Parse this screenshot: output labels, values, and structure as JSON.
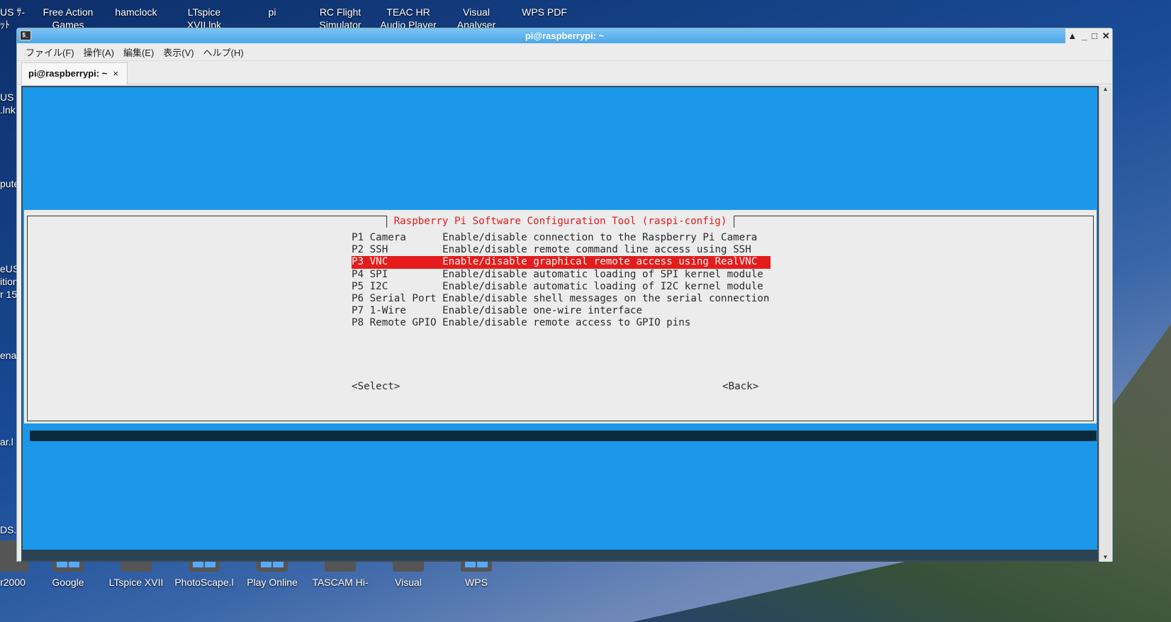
{
  "desktop": {
    "top_icons": [
      {
        "label": "Free Action",
        "sub": "Games"
      },
      {
        "label": "hamclock",
        "sub": ""
      },
      {
        "label": "LTspice",
        "sub": "XVII.lnk"
      },
      {
        "label": "pi",
        "sub": ""
      },
      {
        "label": "RC Flight",
        "sub": "Simulator"
      },
      {
        "label": "TEAC HR",
        "sub": "Audio Player"
      },
      {
        "label": "Visual",
        "sub": "Analyser"
      },
      {
        "label": "WPS PDF",
        "sub": ""
      }
    ],
    "top_left_partial": "US ｻ-\nｯﾄ",
    "left_partial": [
      "US\n.lnk",
      "pute",
      "eUS\nition\nr 15",
      "enar",
      "ar.l",
      "DS.j"
    ],
    "bottom_icons": [
      "r2000",
      "Google",
      "LTspice XVII",
      "PhotoScape.l",
      "Play Online",
      "TASCAM Hi-",
      "Visual",
      "WPS"
    ]
  },
  "window": {
    "title": "pi@raspberrypi: ~",
    "controls": [
      "▲",
      "_",
      "□",
      "✕"
    ],
    "menu": [
      "ファイル(F)",
      "操作(A)",
      "編集(E)",
      "表示(V)",
      "ヘルプ(H)"
    ],
    "tab": {
      "label": "pi@raspberrypi: ~",
      "close": "×"
    }
  },
  "terminal": {
    "dialog_title": "Raspberry Pi Software Configuration Tool (raspi-config)",
    "selected_index": 2,
    "items": [
      {
        "key": "P1 Camera     ",
        "desc": "Enable/disable connection to the Raspberry Pi Camera"
      },
      {
        "key": "P2 SSH        ",
        "desc": "Enable/disable remote command line access using SSH"
      },
      {
        "key": "P3 VNC        ",
        "desc": "Enable/disable graphical remote access using RealVNC"
      },
      {
        "key": "P4 SPI        ",
        "desc": "Enable/disable automatic loading of SPI kernel module"
      },
      {
        "key": "P5 I2C        ",
        "desc": "Enable/disable automatic loading of I2C kernel module"
      },
      {
        "key": "P6 Serial Port",
        "desc": "Enable/disable shell messages on the serial connection"
      },
      {
        "key": "P7 1-Wire     ",
        "desc": "Enable/disable one-wire interface"
      },
      {
        "key": "P8 Remote GPIO",
        "desc": "Enable/disable remote access to GPIO pins"
      }
    ],
    "select_button": "<Select>",
    "back_button": "<Back>",
    "colors": {
      "background": "#1c98ea",
      "dialog": "#ececec",
      "highlight": "#e41c1c",
      "title": "#e21b1b"
    }
  }
}
